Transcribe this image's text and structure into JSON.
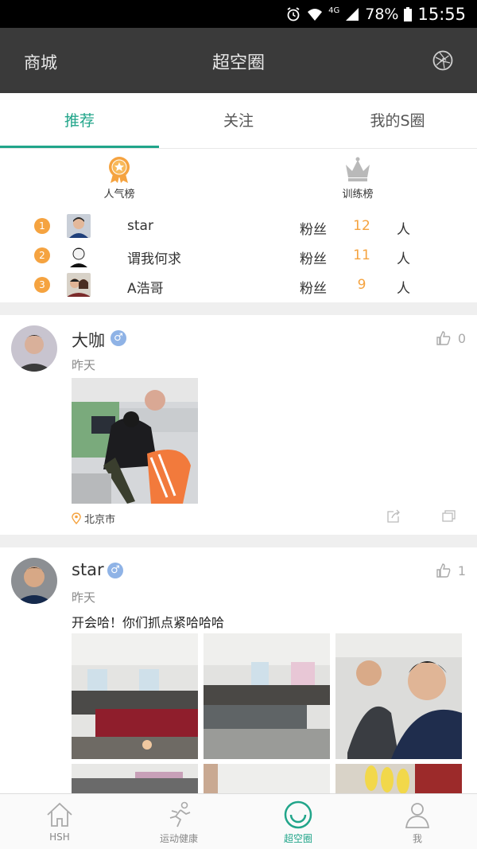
{
  "status_bar": {
    "network": "4G",
    "battery": "78%",
    "time": "15:55"
  },
  "app_bar": {
    "left_label": "商城",
    "title": "超空圈",
    "right_icon": "camera-shutter-icon"
  },
  "tabs": [
    {
      "label": "推荐",
      "active": true
    },
    {
      "label": "关注",
      "active": false
    },
    {
      "label": "我的S圈",
      "active": false
    }
  ],
  "leaderboards": {
    "popular_label": "人气榜",
    "training_label": "训练榜",
    "rows": [
      {
        "rank": "1",
        "name": "star",
        "fans_label": "粉丝",
        "count": "12",
        "unit": "人"
      },
      {
        "rank": "2",
        "name": "谓我何求",
        "fans_label": "粉丝",
        "count": "11",
        "unit": "人"
      },
      {
        "rank": "3",
        "name": "A浩哥",
        "fans_label": "粉丝",
        "count": "9",
        "unit": "人"
      }
    ]
  },
  "posts": [
    {
      "author": "大咖",
      "gender": "♂",
      "time": "昨天",
      "likes": "0",
      "text": "",
      "location": "北京市",
      "photo_count": 1
    },
    {
      "author": "star",
      "gender": "♂",
      "time": "昨天",
      "likes": "1",
      "text": "开会哈！你们抓点紧哈哈哈",
      "location": "",
      "photo_count": 6
    }
  ],
  "bottom_nav": [
    {
      "label": "HSH",
      "icon": "home-icon",
      "active": false
    },
    {
      "label": "运动健康",
      "icon": "running-icon",
      "active": false
    },
    {
      "label": "超空圈",
      "icon": "circle-icon",
      "active": true
    },
    {
      "label": "我",
      "icon": "person-icon",
      "active": false
    }
  ],
  "colors": {
    "accent": "#21a58a",
    "rank_orange": "#f5a340",
    "appbar": "#3a3a3a"
  }
}
